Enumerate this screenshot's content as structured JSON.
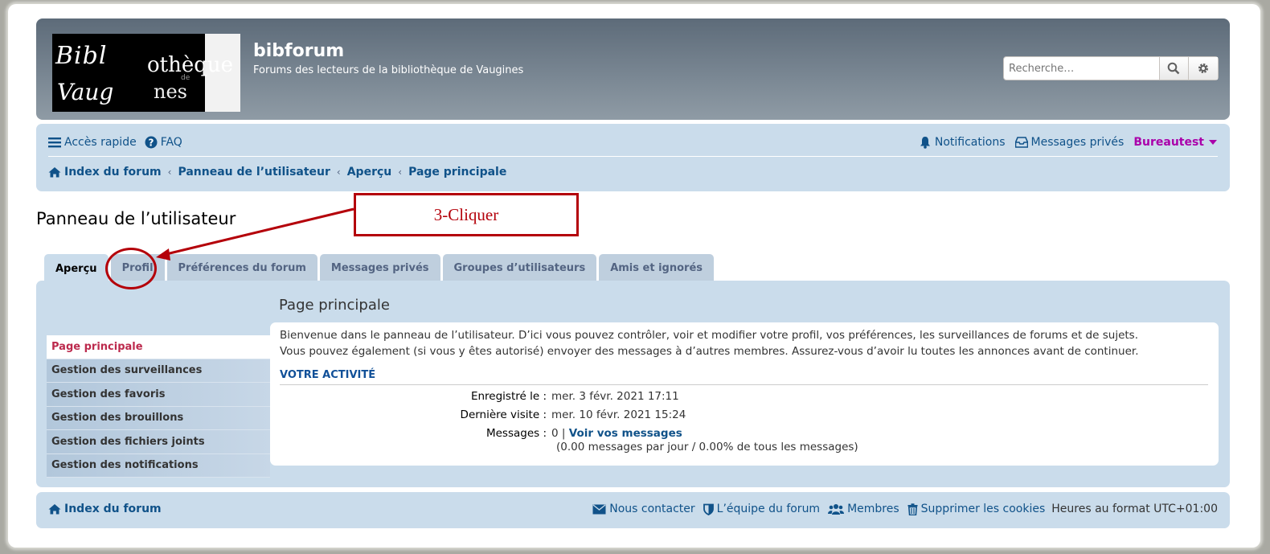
{
  "header": {
    "logo": {
      "line1": "Bibl",
      "line1b": "othèque",
      "line2": "Vaug",
      "line2b": "nes",
      "small": "de"
    },
    "site_title": "bibforum",
    "site_description": "Forums des lecteurs de la bibliothèque de Vaugines",
    "search_placeholder": "Recherche…"
  },
  "navbar": {
    "quick_access": "Accès rapide",
    "faq": "FAQ",
    "notifications": "Notifications",
    "private_messages": "Messages privés",
    "username": "Bureautest",
    "user_color": "#aa00aa"
  },
  "breadcrumbs": [
    "Index du forum",
    "Panneau de l’utilisateur",
    "Aperçu",
    "Page principale"
  ],
  "page_title": "Panneau de l’utilisateur",
  "tabs": [
    {
      "label": "Aperçu",
      "active": true
    },
    {
      "label": "Profil",
      "active": false
    },
    {
      "label": "Préférences du forum",
      "active": false
    },
    {
      "label": "Messages privés",
      "active": false
    },
    {
      "label": "Groupes d’utilisateurs",
      "active": false
    },
    {
      "label": "Amis et ignorés",
      "active": false
    }
  ],
  "sidebar": [
    {
      "label": "Page principale",
      "active": true
    },
    {
      "label": "Gestion des surveillances"
    },
    {
      "label": "Gestion des favoris"
    },
    {
      "label": "Gestion des brouillons"
    },
    {
      "label": "Gestion des fichiers joints"
    },
    {
      "label": "Gestion des notifications"
    }
  ],
  "main": {
    "title": "Page principale",
    "intro_line1": "Bienvenue dans le panneau de l’utilisateur. D’ici vous pouvez contrôler, voir et modifier votre profil, vos préférences, les surveillances de forums et de sujets.",
    "intro_line2": "Vous pouvez également (si vous y êtes autorisé) envoyer des messages à d’autres membres. Assurez-vous d’avoir lu toutes les annonces avant de continuer.",
    "section": "VOTRE ACTIVITÉ",
    "registered_label": "Enregistré le :",
    "registered_value": "mer. 3 févr. 2021 17:11",
    "last_visit_label": "Dernière visite :",
    "last_visit_value": "mer. 10 févr. 2021 15:24",
    "messages_label": "Messages :",
    "messages_count": "0 |",
    "messages_link": "Voir vos messages",
    "messages_stats": "(0.00 messages par jour / 0.00% de tous les messages)"
  },
  "footer": {
    "index": "Index du forum",
    "contact": "Nous contacter",
    "team": "L’équipe du forum",
    "members": "Membres",
    "delete_cookies": "Supprimer les cookies",
    "timezone": "Heures au format UTC+01:00"
  },
  "annotation": {
    "label": "3-Cliquer",
    "color": "#b4010a"
  }
}
